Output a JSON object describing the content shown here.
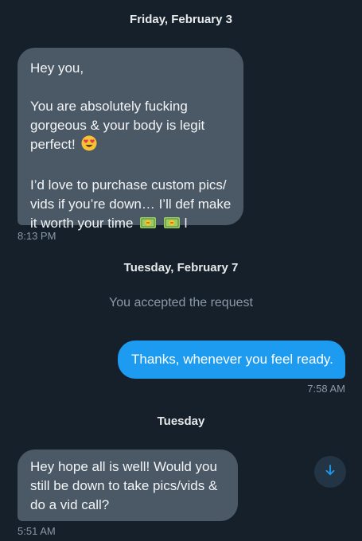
{
  "dates": {
    "first": "Friday, February 3",
    "second": "Tuesday, February 7",
    "third": "Tuesday"
  },
  "messages": {
    "m1": {
      "lines": {
        "l1": "Hey you,",
        "l2": "You are absolutely fucking",
        "l3": "gorgeous & your body is legit",
        "l4": "perfect!",
        "l5": "I’d love to purchase custom pics/",
        "l6": "vids if you’re down… I’ll def make",
        "l7": "it worth your time",
        "l7_tail": "l"
      },
      "time": "8:13 PM"
    },
    "m2": {
      "text": "Thanks, whenever you feel ready.",
      "time": "7:58 AM"
    },
    "m3": {
      "lines": {
        "l1": "Hey hope all is well! Would you",
        "l2": "still be down to take pics/vids &",
        "l3": "do a vid call?"
      },
      "time": "5:51 AM"
    }
  },
  "system": {
    "accepted": "You accepted the request"
  },
  "icons": {
    "emoji_1": "heart-eyes-emoji-icon",
    "emoji_2": "money-bag-emoji-icon",
    "scroll": "arrow-down-icon"
  },
  "colors": {
    "background": "#15202b",
    "incoming_bubble": "#4b5967",
    "outgoing_bubble": "#1d9bf0",
    "secondary_text": "#8b98a5"
  }
}
